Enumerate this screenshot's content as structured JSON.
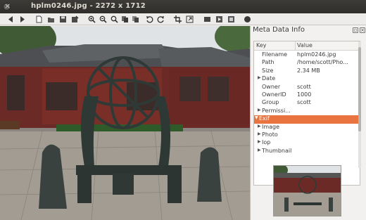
{
  "window": {
    "title": "hplm0246.jpg - 2272 x 1712"
  },
  "toolbar": {
    "buttons": [
      {
        "name": "back-icon"
      },
      {
        "name": "forward-icon"
      },
      {
        "name": "open-icon"
      },
      {
        "name": "open-folder-icon"
      },
      {
        "name": "save-icon"
      },
      {
        "name": "save-as-icon"
      },
      {
        "name": "zoom-in-icon"
      },
      {
        "name": "zoom-out-icon"
      },
      {
        "name": "zoom-fit-icon"
      },
      {
        "name": "copy-icon"
      },
      {
        "name": "paste-icon"
      },
      {
        "name": "rotate-left-icon"
      },
      {
        "name": "rotate-right-icon"
      },
      {
        "name": "crop-icon"
      },
      {
        "name": "resize-icon"
      },
      {
        "name": "fullscreen-icon"
      },
      {
        "name": "slideshow-icon"
      },
      {
        "name": "gallery-icon"
      },
      {
        "name": "exit-icon"
      }
    ]
  },
  "meta_panel": {
    "title": "Meta Data Info",
    "header": {
      "key": "Key",
      "value": "Value"
    },
    "rows": [
      {
        "key": "Filename",
        "value": "hplm0246.jpg",
        "indent": 2,
        "arrow": ""
      },
      {
        "key": "Path",
        "value": "/home/scott/Pho...",
        "indent": 2,
        "arrow": ""
      },
      {
        "key": "Size",
        "value": "2.34 MB",
        "indent": 2,
        "arrow": ""
      },
      {
        "key": "Date",
        "value": "",
        "indent": 1,
        "arrow": "▶"
      },
      {
        "key": "Owner",
        "value": "scott",
        "indent": 2,
        "arrow": ""
      },
      {
        "key": "OwnerID",
        "value": "1000",
        "indent": 2,
        "arrow": ""
      },
      {
        "key": "Group",
        "value": "scott",
        "indent": 2,
        "arrow": ""
      },
      {
        "key": "Permissi...",
        "value": "",
        "indent": 1,
        "arrow": "▶"
      },
      {
        "key": "Exif",
        "value": "",
        "indent": 0,
        "arrow": "▼",
        "selected": true
      },
      {
        "key": "Image",
        "value": "",
        "indent": 1,
        "arrow": "▶"
      },
      {
        "key": "Photo",
        "value": "",
        "indent": 1,
        "arrow": "▶"
      },
      {
        "key": "Iop",
        "value": "",
        "indent": 1,
        "arrow": "▶"
      },
      {
        "key": "Thumbnail",
        "value": "",
        "indent": 1,
        "arrow": "▶"
      }
    ]
  }
}
